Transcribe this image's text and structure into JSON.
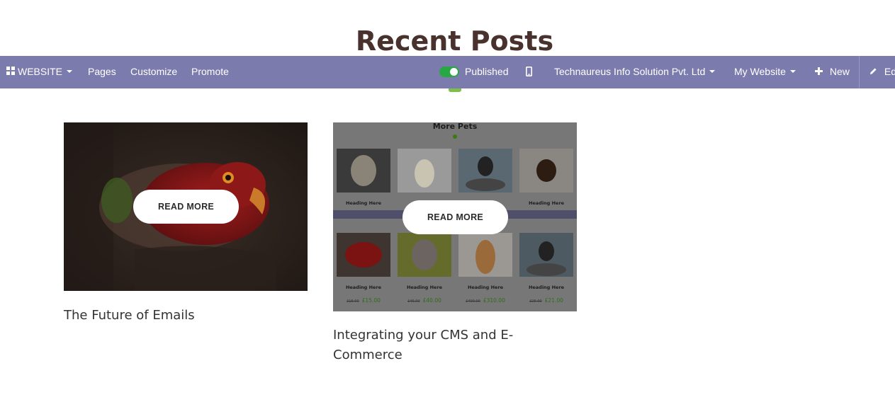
{
  "section": {
    "title": "Recent Posts"
  },
  "navbar": {
    "website_menu": "WEBSITE",
    "pages": "Pages",
    "customize": "Customize",
    "promote": "Promote",
    "published": "Published",
    "company": "Technaureus Info Solution Pvt. Ltd",
    "my_website": "My Website",
    "new": "New",
    "edit": "Edit"
  },
  "posts": [
    {
      "title": "The Future of Emails",
      "read_more": "READ MORE"
    },
    {
      "title": "Integrating your CMS and E-Commerce",
      "read_more": "READ MORE",
      "preview": {
        "title": "More Pets",
        "headings": [
          "Heading Here",
          "Heading Here",
          "Heading Here",
          "Heading Here",
          "Heading Here",
          "Heading Here"
        ],
        "prices": [
          {
            "old": "£15.00",
            "new": "£15.00"
          },
          {
            "old": "£45.00",
            "new": "£40.00"
          },
          {
            "old": "£400.00",
            "new": "£310.00"
          },
          {
            "old": "£25.00",
            "new": "£21.00"
          }
        ]
      }
    }
  ],
  "colors": {
    "navbar_bg": "#7c7bad",
    "toggle_on": "#28a745",
    "title_color": "#49312e",
    "price_green": "#2f6d1a"
  }
}
